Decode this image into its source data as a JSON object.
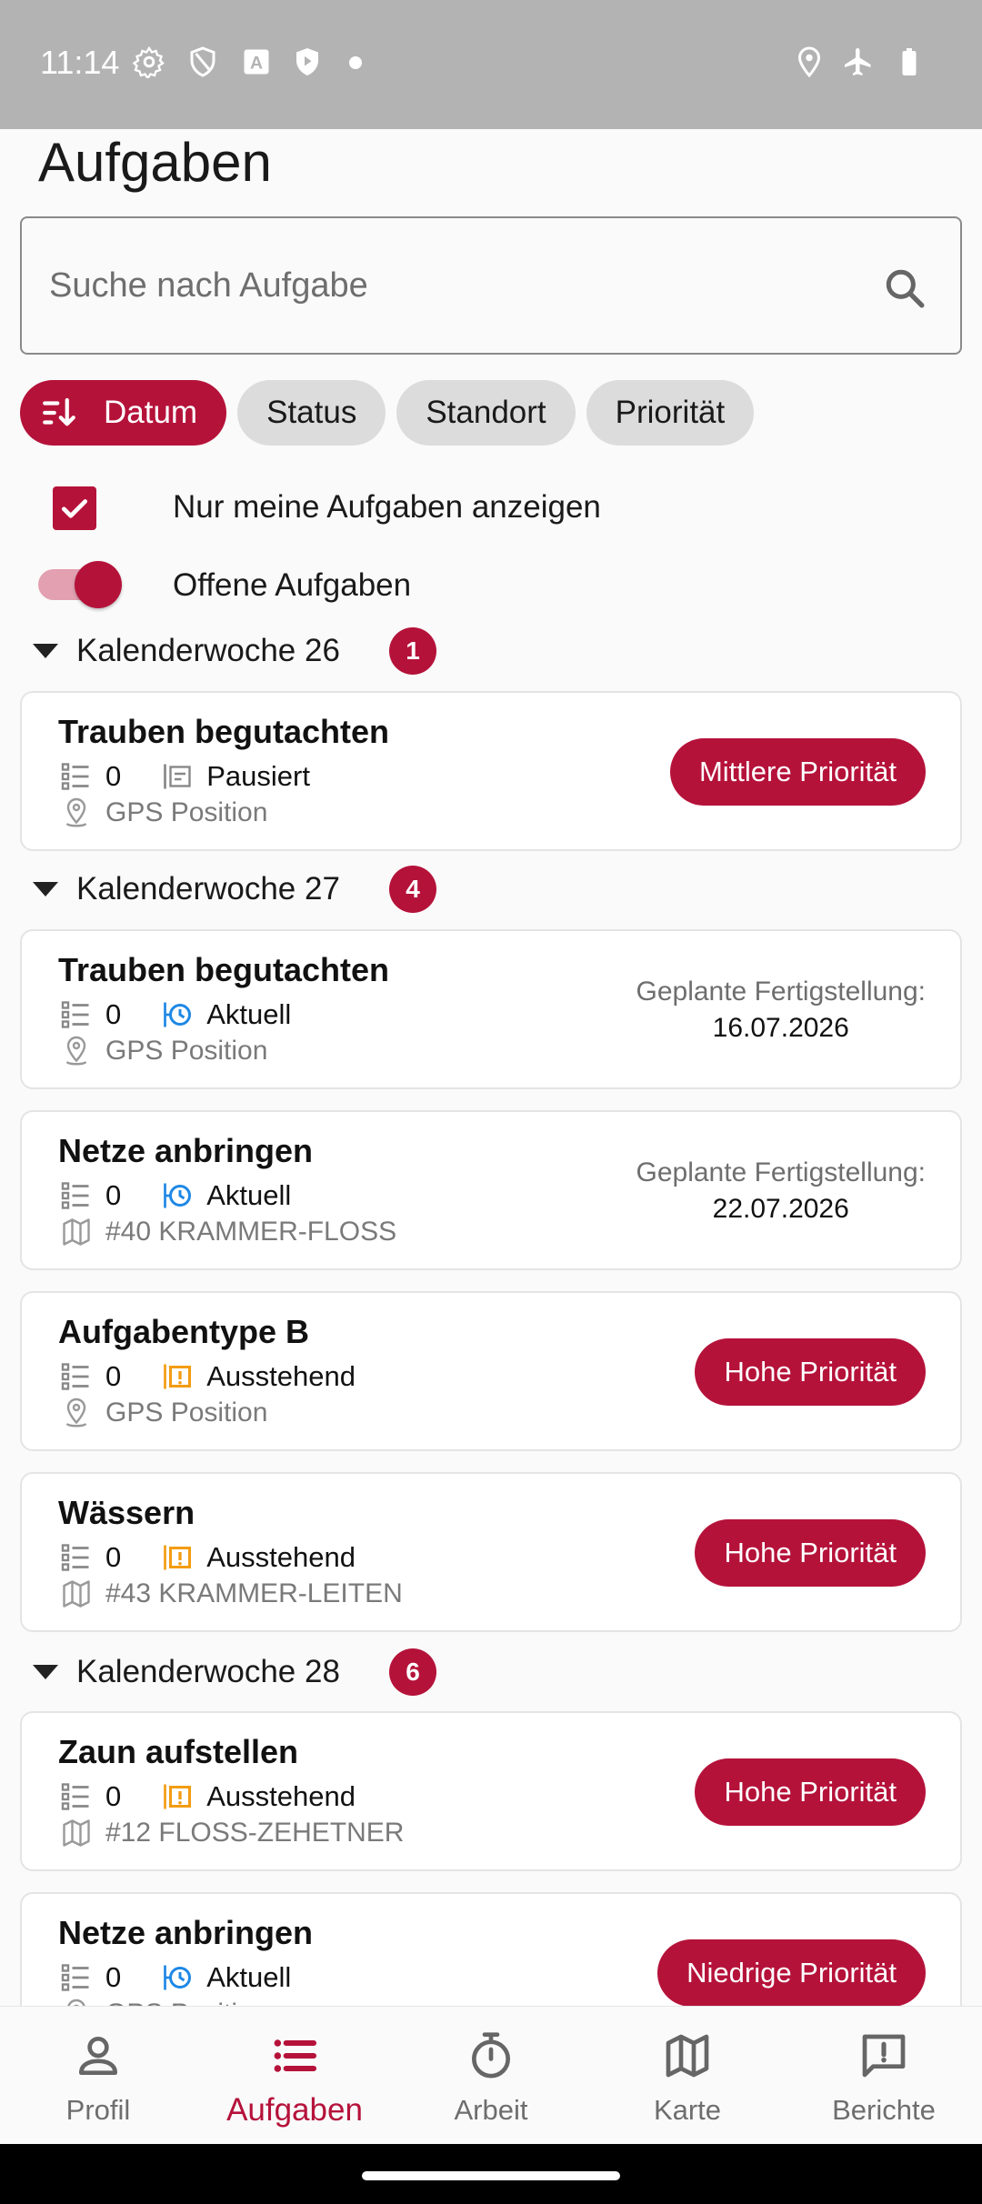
{
  "status_bar": {
    "time": "11:14"
  },
  "page": {
    "title": "Aufgaben"
  },
  "search": {
    "placeholder": "Suche nach Aufgabe"
  },
  "filters": {
    "chips": [
      "Datum",
      "Status",
      "Standort",
      "Priorität"
    ],
    "active": "Datum"
  },
  "options": {
    "only_mine": {
      "label": "Nur meine Aufgaben anzeigen",
      "checked": true
    },
    "open_tasks": {
      "label": "Offene Aufgaben",
      "on": true
    }
  },
  "weeks": [
    {
      "label": "Kalenderwoche 26",
      "count": "1"
    },
    {
      "label": "Kalenderwoche 27",
      "count": "4"
    },
    {
      "label": "Kalenderwoche 28",
      "count": "6"
    }
  ],
  "tasks": [
    {
      "title": "Trauben begutachten",
      "count": "0",
      "status": "Pausiert",
      "location": "GPS Position",
      "priority": "Mittlere Priorität"
    },
    {
      "title": "Trauben begutachten",
      "count": "0",
      "status": "Aktuell",
      "location": "GPS Position",
      "planned_label": "Geplante Fertigstellung:",
      "planned_date": "16.07.2026"
    },
    {
      "title": "Netze anbringen",
      "count": "0",
      "status": "Aktuell",
      "location": "#40 KRAMMER-FLOSS",
      "planned_label": "Geplante Fertigstellung:",
      "planned_date": "22.07.2026"
    },
    {
      "title": "Aufgabentype B",
      "count": "0",
      "status": "Ausstehend",
      "location": "GPS Position",
      "priority": "Hohe Priorität"
    },
    {
      "title": "Wässern",
      "count": "0",
      "status": "Ausstehend",
      "location": "#43 KRAMMER-LEITEN",
      "priority": "Hohe Priorität"
    },
    {
      "title": "Zaun aufstellen",
      "count": "0",
      "status": "Ausstehend",
      "location": "#12 FLOSS-ZEHETNER",
      "priority": "Hohe Priorität"
    },
    {
      "title": "Netze anbringen",
      "count": "0",
      "status": "Aktuell",
      "location": "GPS Position",
      "priority": "Niedrige Priorität"
    }
  ],
  "bottom_nav": [
    {
      "label": "Profil",
      "icon": "person-icon"
    },
    {
      "label": "Aufgaben",
      "icon": "list-icon",
      "active": true
    },
    {
      "label": "Arbeit",
      "icon": "stopwatch-icon"
    },
    {
      "label": "Karte",
      "icon": "map-icon"
    },
    {
      "label": "Berichte",
      "icon": "report-icon"
    }
  ],
  "colors": {
    "accent": "#b5123a",
    "active_status": "#1e88e5",
    "pending_status": "#f39c12"
  }
}
